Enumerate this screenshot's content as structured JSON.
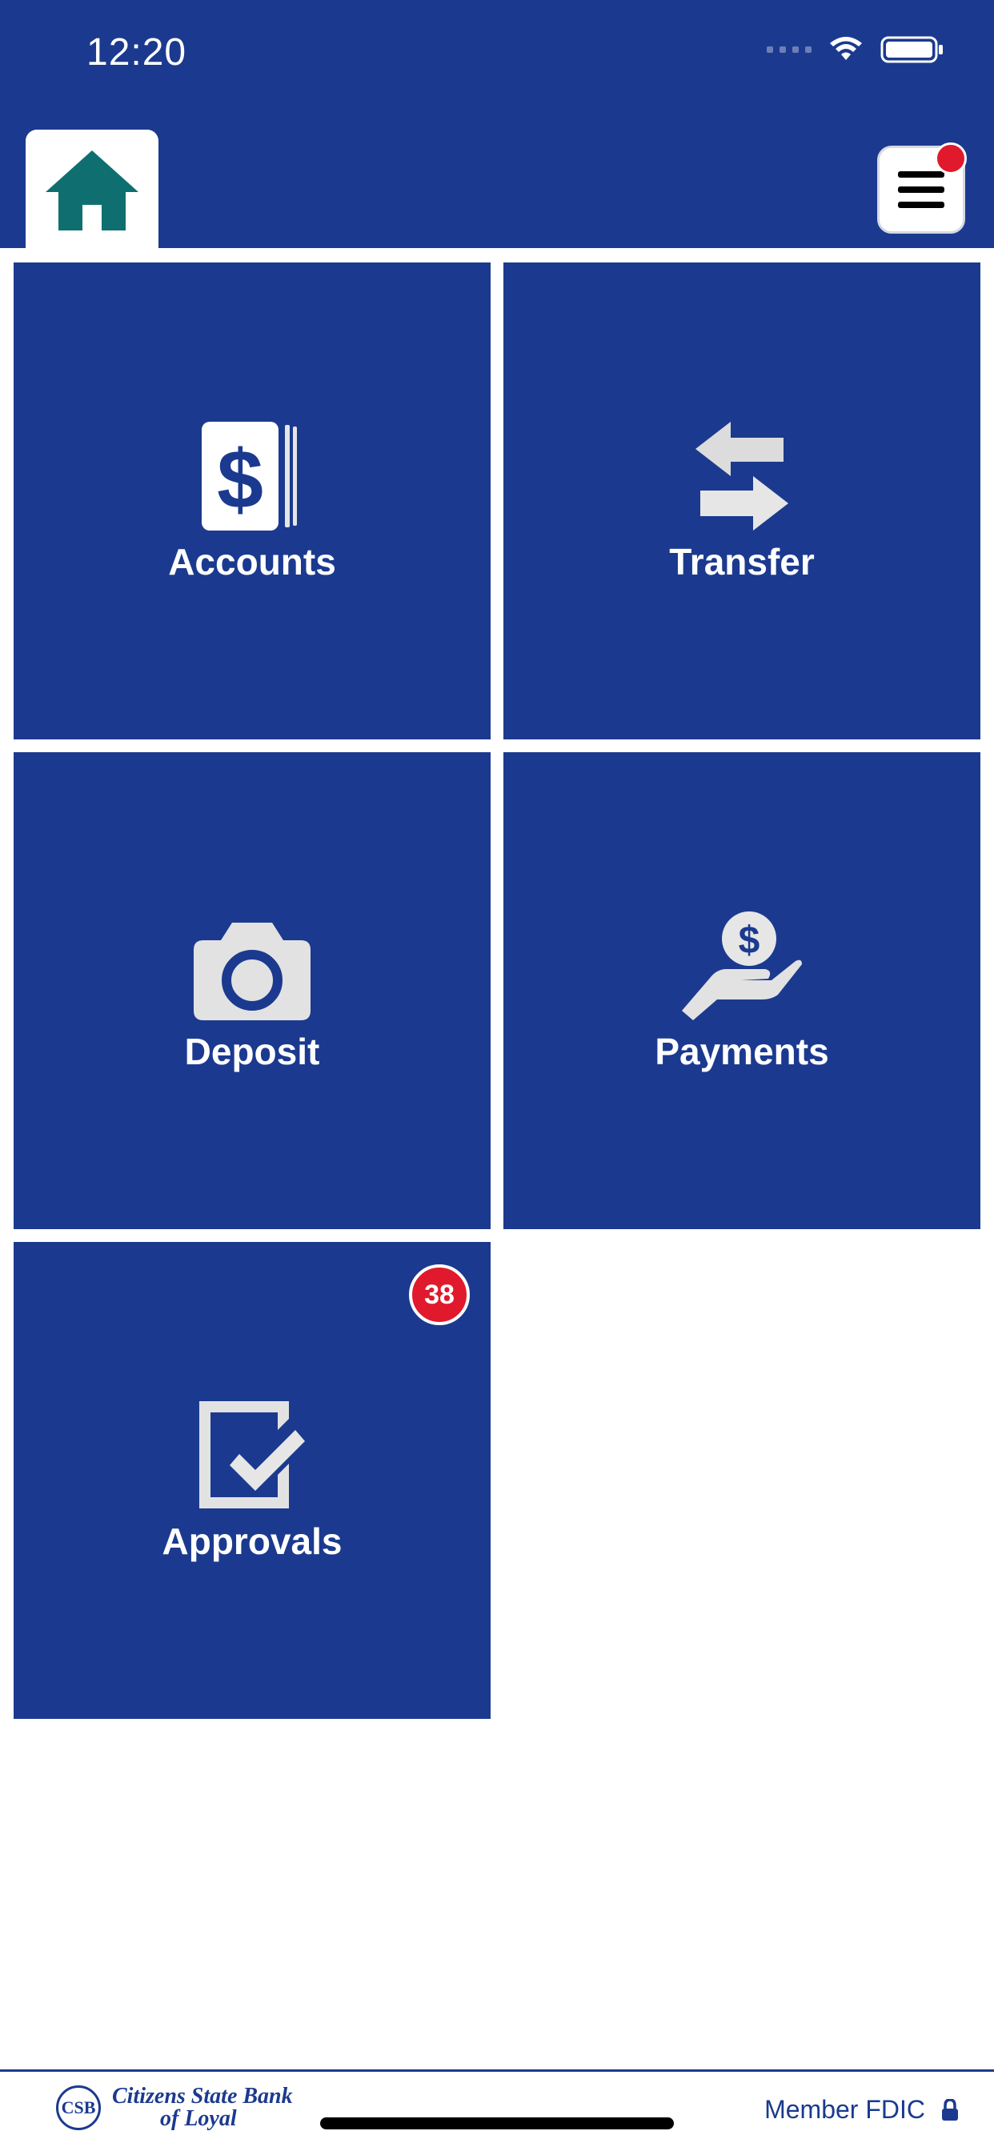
{
  "status_bar": {
    "time": "12:20"
  },
  "nav": {
    "home_icon": "home-icon",
    "menu_icon": "hamburger-menu-icon"
  },
  "tiles": [
    {
      "label": "Accounts",
      "icon": "dollar-cards-icon"
    },
    {
      "label": "Transfer",
      "icon": "transfer-arrows-icon"
    },
    {
      "label": "Deposit",
      "icon": "camera-icon"
    },
    {
      "label": "Payments",
      "icon": "hand-coin-icon"
    },
    {
      "label": "Approvals",
      "icon": "checkbox-icon",
      "badge": "38"
    }
  ],
  "footer": {
    "bank_name_line1": "Citizens State Bank",
    "bank_name_line2": "of Loyal",
    "seal_text": "CSB",
    "member_text": "Member FDIC"
  },
  "colors": {
    "brand_blue": "#1b3a8f",
    "home_green": "#0f6f70",
    "badge_red": "#e0192d"
  }
}
